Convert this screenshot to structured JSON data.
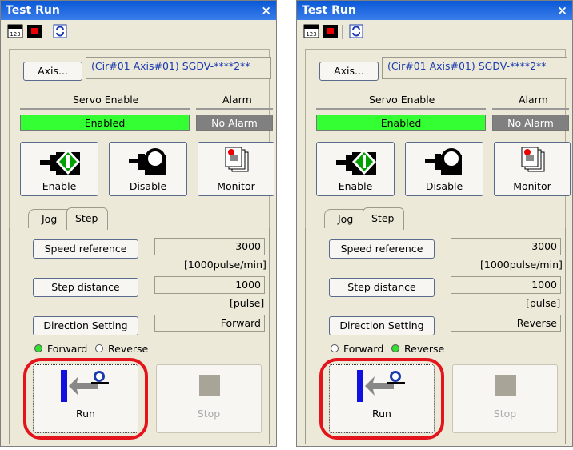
{
  "panels": [
    {
      "title": "Test Run",
      "close": "×",
      "axis_button": "Axis...",
      "axis_value": "(Cir#01 Axis#01) SGDV-****2**",
      "servo_enable_label": "Servo Enable",
      "alarm_label": "Alarm",
      "servo_status": "Enabled",
      "alarm_status": "No Alarm",
      "enable_button": "Enable",
      "disable_button": "Disable",
      "monitor_button": "Monitor",
      "tab_jog": "Jog",
      "tab_step": "Step",
      "speed_button": "Speed reference",
      "speed_value": "3000",
      "speed_unit": "[1000pulse/min]",
      "step_button": "Step distance",
      "step_value": "1000",
      "step_unit": "[pulse]",
      "direction_button": "Direction Setting",
      "direction_value": "Forward",
      "forward_label": "Forward",
      "reverse_label": "Reverse",
      "forward_selected": true,
      "run_button": "Run",
      "stop_button": "Stop"
    },
    {
      "title": "Test Run",
      "close": "×",
      "axis_button": "Axis...",
      "axis_value": "(Cir#01 Axis#01) SGDV-****2**",
      "servo_enable_label": "Servo Enable",
      "alarm_label": "Alarm",
      "servo_status": "Enabled",
      "alarm_status": "No Alarm",
      "enable_button": "Enable",
      "disable_button": "Disable",
      "monitor_button": "Monitor",
      "tab_jog": "Jog",
      "tab_step": "Step",
      "speed_button": "Speed reference",
      "speed_value": "3000",
      "speed_unit": "[1000pulse/min]",
      "step_button": "Step distance",
      "step_value": "1000",
      "step_unit": "[pulse]",
      "direction_button": "Direction Setting",
      "direction_value": "Reverse",
      "forward_label": "Forward",
      "reverse_label": "Reverse",
      "forward_selected": false,
      "run_button": "Run",
      "stop_button": "Stop"
    }
  ],
  "colors": {
    "enabled_green": "#33ff33",
    "alarm_gray": "#808080",
    "highlight_ring": "#e3141b",
    "radio_selected": "#33dd33"
  }
}
